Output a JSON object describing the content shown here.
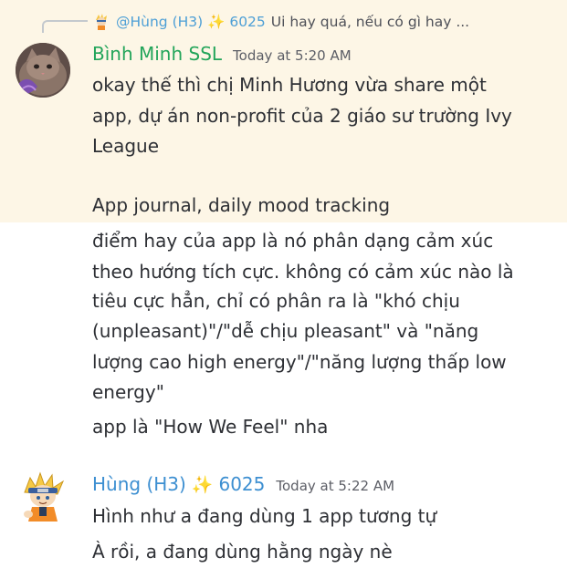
{
  "messages": {
    "bm": {
      "reply": {
        "author": "@Hùng (H3) ✨ 6025",
        "text": "Ui hay quá, nếu có gì hay ..."
      },
      "author": "Bình Minh SSL",
      "timestamp": "Today at 5:20 AM",
      "lines": [
        "okay thế thì chị Minh Hương vừa share một",
        "app, dự án non-profit của 2 giáo sư trường Ivy",
        "League",
        "",
        " App journal, daily mood tracking"
      ],
      "followup": [
        "điểm hay của app là nó phân dạng cảm xúc",
        "theo hướng tích cực. không có cảm xúc nào là",
        "tiêu cực hẳn, chỉ có phân ra là \"khó chịu",
        "(unpleasant)\"/\"dễ chịu pleasant\" và \"năng",
        "lượng cao high energy\"/\"năng lượng thấp low",
        "energy\"",
        "app là \"How We Feel\" nha"
      ]
    },
    "hung": {
      "author_name": "Hùng (H3)",
      "sparkle": "✨",
      "author_number": "6025",
      "timestamp": "Today at 5:22 AM",
      "lines": [
        "Hình như a đang dùng 1 app tương tự",
        "À rồi, a đang dùng hằng ngày nè"
      ]
    }
  },
  "colors": {
    "highlight_bg": "#fdf6e6",
    "author_green": "#23a55a",
    "author_blue": "#3d8fd1"
  }
}
